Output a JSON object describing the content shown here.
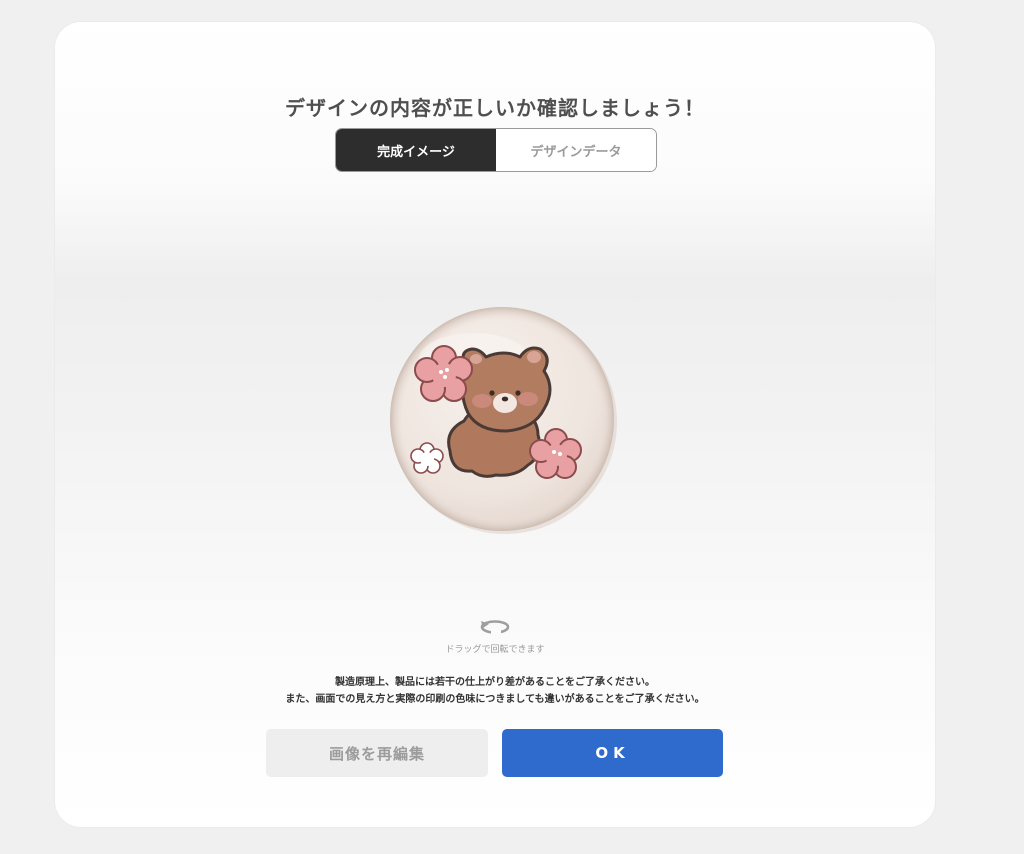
{
  "dialog": {
    "title": "デザインの内容が正しいか確認しましょう！"
  },
  "tabs": [
    {
      "label": "完成イメージ",
      "active": true
    },
    {
      "label": "デザインデータ",
      "active": false
    }
  ],
  "preview": {
    "rotate_icon": "rotate-icon",
    "rotate_hint": "ドラッグで回転できます"
  },
  "notice": {
    "line1": "製造原理上、製品には若干の仕上がり差があることをご了承ください。",
    "line2": "また、画面での見え方と実際の印刷の色味につきましても違いがあることをご了承ください。"
  },
  "buttons": {
    "edit_label": "画像を再編集",
    "ok_label": "OK"
  },
  "colors": {
    "primary": "#2e6bcd",
    "active_tab": "#2d2d2d",
    "badge_bg": "#efe6e1",
    "bear": "#b07a5e",
    "flower": "#e8a4a6"
  }
}
